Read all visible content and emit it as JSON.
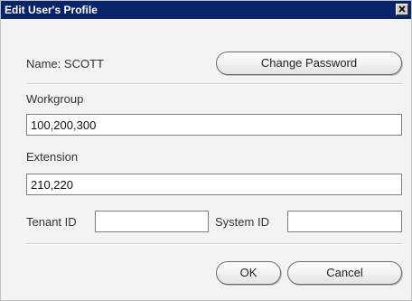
{
  "window": {
    "title": "Edit User's Profile",
    "close_icon": "close-icon"
  },
  "profile": {
    "name_label": "Name: SCOTT",
    "change_password_label": "Change Password"
  },
  "workgroup": {
    "label": "Workgroup",
    "value": "100,200,300"
  },
  "extension": {
    "label": "Extension",
    "value": "210,220"
  },
  "tenant": {
    "label": "Tenant ID",
    "value": ""
  },
  "system": {
    "label": "System ID",
    "value": ""
  },
  "actions": {
    "ok_label": "OK",
    "cancel_label": "Cancel"
  },
  "colors": {
    "titlebar": "#0a246a",
    "dialog_bg": "#f3f3f3"
  }
}
